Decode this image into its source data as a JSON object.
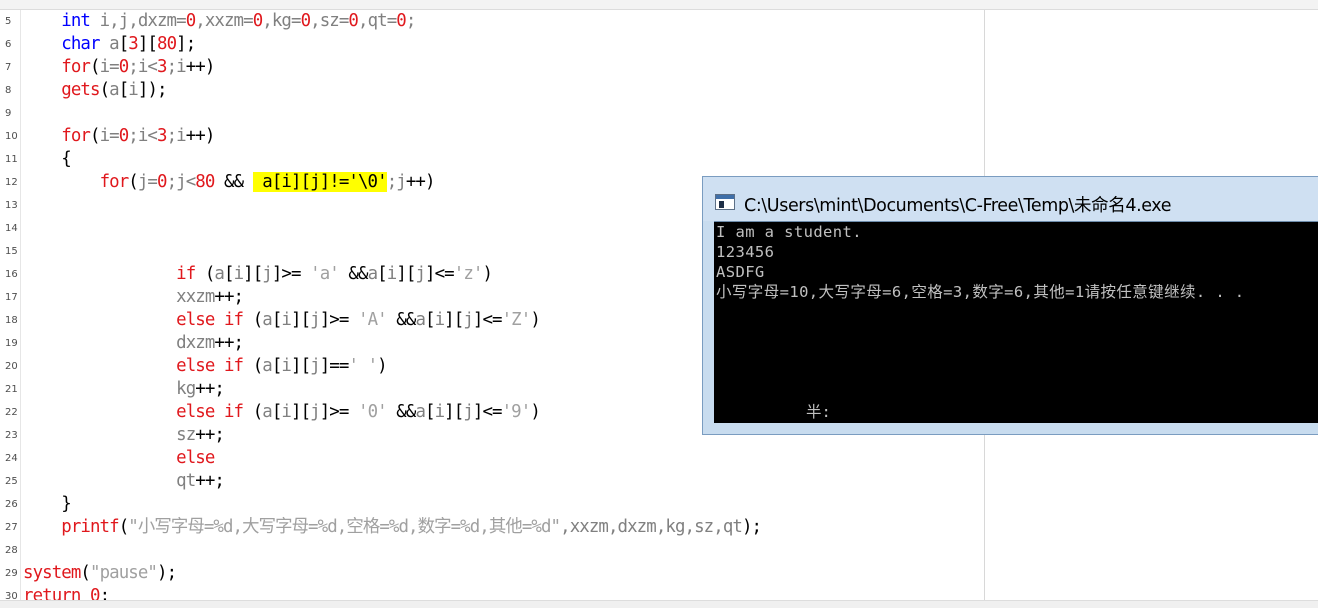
{
  "editor": {
    "lines": [
      {
        "num": "5",
        "tokens": [
          [
            "t",
            "    "
          ],
          [
            "ty",
            "int"
          ],
          [
            "vr",
            " i,j,dxzm="
          ],
          [
            "nm",
            "0"
          ],
          [
            "vr",
            ",xxzm="
          ],
          [
            "nm",
            "0"
          ],
          [
            "vr",
            ",kg="
          ],
          [
            "nm",
            "0"
          ],
          [
            "vr",
            ",sz="
          ],
          [
            "nm",
            "0"
          ],
          [
            "vr",
            ",qt="
          ],
          [
            "nm",
            "0"
          ],
          [
            "vr",
            ";"
          ]
        ]
      },
      {
        "num": "6",
        "tokens": [
          [
            "t",
            "    "
          ],
          [
            "ty",
            "char"
          ],
          [
            "vr",
            " a"
          ],
          [
            "tx",
            "["
          ],
          [
            "nm",
            "3"
          ],
          [
            "tx",
            "]["
          ],
          [
            "nm",
            "80"
          ],
          [
            "tx",
            "];"
          ]
        ]
      },
      {
        "num": "7",
        "tokens": [
          [
            "t",
            "    "
          ],
          [
            "kw",
            "for"
          ],
          [
            "tx",
            "("
          ],
          [
            "vr",
            "i="
          ],
          [
            "nm",
            "0"
          ],
          [
            "vr",
            ";i<"
          ],
          [
            "nm",
            "3"
          ],
          [
            "vr",
            ";i"
          ],
          [
            "tx",
            "++)"
          ]
        ]
      },
      {
        "num": "8",
        "tokens": [
          [
            "t",
            "    "
          ],
          [
            "kw",
            "gets"
          ],
          [
            "tx",
            "("
          ],
          [
            "vr",
            "a"
          ],
          [
            "tx",
            "["
          ],
          [
            "vr",
            "i"
          ],
          [
            "tx",
            "]);"
          ]
        ]
      },
      {
        "num": "9",
        "tokens": []
      },
      {
        "num": "10",
        "tokens": [
          [
            "t",
            "    "
          ],
          [
            "kw",
            "for"
          ],
          [
            "tx",
            "("
          ],
          [
            "vr",
            "i="
          ],
          [
            "nm",
            "0"
          ],
          [
            "vr",
            ";i<"
          ],
          [
            "nm",
            "3"
          ],
          [
            "vr",
            ";i"
          ],
          [
            "tx",
            "++)"
          ]
        ]
      },
      {
        "num": "11",
        "tokens": [
          [
            "t",
            "    "
          ],
          [
            "tx",
            "{"
          ]
        ]
      },
      {
        "num": "12",
        "tokens": [
          [
            "t",
            "        "
          ],
          [
            "kw",
            "for"
          ],
          [
            "tx",
            "("
          ],
          [
            "vr",
            "j="
          ],
          [
            "nm",
            "0"
          ],
          [
            "vr",
            ";j<"
          ],
          [
            "nm",
            "80"
          ],
          [
            "tx",
            " && "
          ],
          [
            "hl",
            " a[i][j]!='\\0'"
          ],
          [
            "vr",
            ";j"
          ],
          [
            "tx",
            "++)"
          ]
        ]
      },
      {
        "num": "13",
        "tokens": []
      },
      {
        "num": "14",
        "tokens": []
      },
      {
        "num": "15",
        "tokens": []
      },
      {
        "num": "16",
        "tokens": [
          [
            "t",
            "                "
          ],
          [
            "kw",
            "if"
          ],
          [
            "tx",
            " ("
          ],
          [
            "vr",
            "a"
          ],
          [
            "tx",
            "["
          ],
          [
            "vr",
            "i"
          ],
          [
            "tx",
            "]["
          ],
          [
            "vr",
            "j"
          ],
          [
            "tx",
            "]>= "
          ],
          [
            "st",
            "'a'"
          ],
          [
            "tx",
            " &&"
          ],
          [
            "vr",
            "a"
          ],
          [
            "tx",
            "["
          ],
          [
            "vr",
            "i"
          ],
          [
            "tx",
            "]["
          ],
          [
            "vr",
            "j"
          ],
          [
            "tx",
            "]<="
          ],
          [
            "st",
            "'z'"
          ],
          [
            "tx",
            ")"
          ]
        ]
      },
      {
        "num": "17",
        "tokens": [
          [
            "t",
            "                "
          ],
          [
            "vr",
            "xxzm"
          ],
          [
            "tx",
            "++;"
          ]
        ]
      },
      {
        "num": "18",
        "tokens": [
          [
            "t",
            "                "
          ],
          [
            "kw",
            "else if"
          ],
          [
            "tx",
            " ("
          ],
          [
            "vr",
            "a"
          ],
          [
            "tx",
            "["
          ],
          [
            "vr",
            "i"
          ],
          [
            "tx",
            "]["
          ],
          [
            "vr",
            "j"
          ],
          [
            "tx",
            "]>= "
          ],
          [
            "st",
            "'A'"
          ],
          [
            "tx",
            " &&"
          ],
          [
            "vr",
            "a"
          ],
          [
            "tx",
            "["
          ],
          [
            "vr",
            "i"
          ],
          [
            "tx",
            "]["
          ],
          [
            "vr",
            "j"
          ],
          [
            "tx",
            "]<="
          ],
          [
            "st",
            "'Z'"
          ],
          [
            "tx",
            ")"
          ]
        ]
      },
      {
        "num": "19",
        "tokens": [
          [
            "t",
            "                "
          ],
          [
            "vr",
            "dxzm"
          ],
          [
            "tx",
            "++;"
          ]
        ]
      },
      {
        "num": "20",
        "tokens": [
          [
            "t",
            "                "
          ],
          [
            "kw",
            "else if"
          ],
          [
            "tx",
            " ("
          ],
          [
            "vr",
            "a"
          ],
          [
            "tx",
            "["
          ],
          [
            "vr",
            "i"
          ],
          [
            "tx",
            "]["
          ],
          [
            "vr",
            "j"
          ],
          [
            "tx",
            "]=="
          ],
          [
            "st",
            "' '"
          ],
          [
            "tx",
            ")"
          ]
        ]
      },
      {
        "num": "21",
        "tokens": [
          [
            "t",
            "                "
          ],
          [
            "vr",
            "kg"
          ],
          [
            "tx",
            "++;"
          ]
        ]
      },
      {
        "num": "22",
        "tokens": [
          [
            "t",
            "                "
          ],
          [
            "kw",
            "else if"
          ],
          [
            "tx",
            " ("
          ],
          [
            "vr",
            "a"
          ],
          [
            "tx",
            "["
          ],
          [
            "vr",
            "i"
          ],
          [
            "tx",
            "]["
          ],
          [
            "vr",
            "j"
          ],
          [
            "tx",
            "]>= "
          ],
          [
            "st",
            "'0'"
          ],
          [
            "tx",
            " &&"
          ],
          [
            "vr",
            "a"
          ],
          [
            "tx",
            "["
          ],
          [
            "vr",
            "i"
          ],
          [
            "tx",
            "]["
          ],
          [
            "vr",
            "j"
          ],
          [
            "tx",
            "]<="
          ],
          [
            "st",
            "'9'"
          ],
          [
            "tx",
            ")"
          ]
        ]
      },
      {
        "num": "23",
        "tokens": [
          [
            "t",
            "                "
          ],
          [
            "vr",
            "sz"
          ],
          [
            "tx",
            "++;"
          ]
        ]
      },
      {
        "num": "24",
        "tokens": [
          [
            "t",
            "                "
          ],
          [
            "kw",
            "else"
          ]
        ]
      },
      {
        "num": "25",
        "tokens": [
          [
            "t",
            "                "
          ],
          [
            "vr",
            "qt"
          ],
          [
            "tx",
            "++;"
          ]
        ]
      },
      {
        "num": "26",
        "tokens": [
          [
            "t",
            "    "
          ],
          [
            "tx",
            "}"
          ]
        ]
      },
      {
        "num": "27",
        "tokens": [
          [
            "t",
            "    "
          ],
          [
            "kw",
            "printf"
          ],
          [
            "tx",
            "("
          ],
          [
            "st",
            "\"小写字母=%d,大写字母=%d,空格=%d,数字=%d,其他=%d\""
          ],
          [
            "vr",
            ",xxzm,dxzm,kg,sz,qt"
          ],
          [
            "tx",
            ");"
          ]
        ]
      },
      {
        "num": "28",
        "tokens": []
      },
      {
        "num": "29",
        "tokens": [
          [
            "kw",
            "system"
          ],
          [
            "tx",
            "("
          ],
          [
            "st",
            "\"pause\""
          ],
          [
            "tx",
            ");"
          ]
        ]
      },
      {
        "num": "30",
        "tokens": [
          [
            "kw",
            "return"
          ],
          [
            "tx",
            " "
          ],
          [
            "nm",
            "0"
          ],
          [
            "tx",
            ";"
          ]
        ]
      }
    ]
  },
  "console": {
    "title": "C:\\Users\\mint\\Documents\\C-Free\\Temp\\未命名4.exe",
    "output": [
      "I am a student.",
      "123456",
      "ASDFG",
      "小写字母=10,大写字母=6,空格=3,数字=6,其他=1请按任意键继续. . ."
    ],
    "ime_indicator": "半:"
  }
}
